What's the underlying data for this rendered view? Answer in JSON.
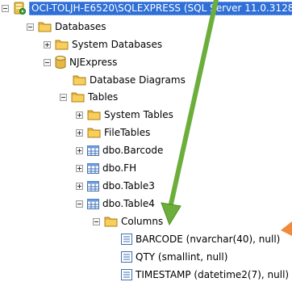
{
  "tree": {
    "server": "OCI-TOLJH-E6520\\SQLEXPRESS (SQL Server 11.0.3128 -",
    "databases": "Databases",
    "system_databases": "System Databases",
    "njexpress": "NJExpress",
    "database_diagrams": "Database Diagrams",
    "tables": "Tables",
    "system_tables": "System Tables",
    "filetables": "FileTables",
    "table_rows": [
      "dbo.Barcode",
      "dbo.FH",
      "dbo.Table3",
      "dbo.Table4"
    ],
    "columns": "Columns",
    "column_items": [
      "BARCODE (nvarchar(40), null)",
      "QTY (smallint, null)",
      "TIMESTAMP (datetime2(7), null)"
    ]
  },
  "colors": {
    "selection": "#2f6fd6",
    "folder": "#e8b53a",
    "arrow_green": "#6cae3b",
    "arrow_orange": "#f08a3c"
  }
}
